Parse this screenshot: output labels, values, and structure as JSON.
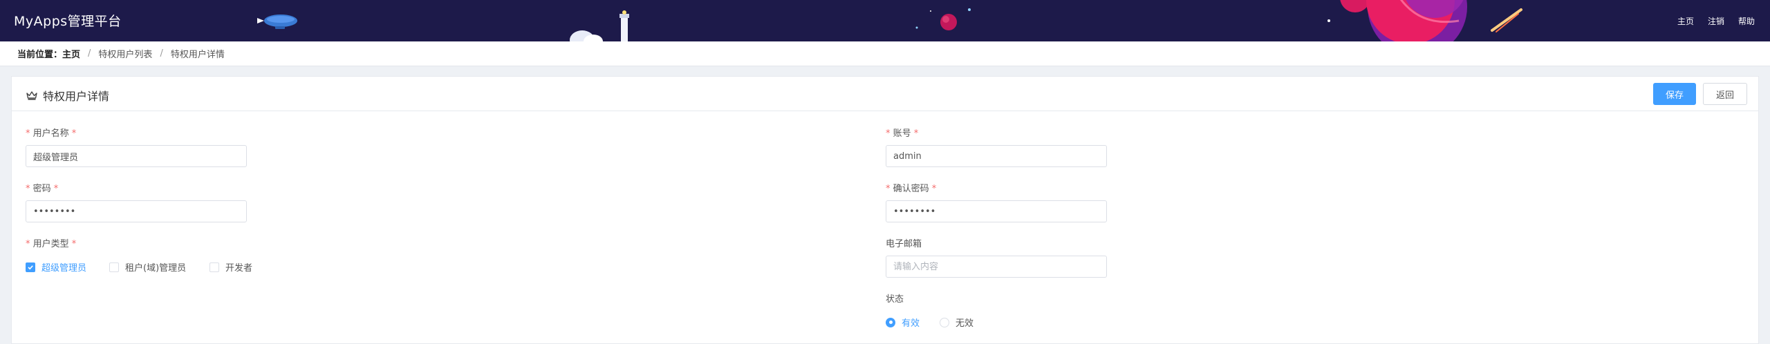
{
  "header": {
    "brand": "MyApps管理平台",
    "nav": [
      "主页",
      "注销",
      "帮助"
    ]
  },
  "breadcrumb": {
    "label": "当前位置：",
    "items": [
      "主页",
      "特权用户列表",
      "特权用户详情"
    ],
    "separator": "/"
  },
  "card": {
    "title": "特权用户详情",
    "save_label": "保存",
    "back_label": "返回"
  },
  "form": {
    "username": {
      "label": "用户名称",
      "value": "超级管理员"
    },
    "account": {
      "label": "账号",
      "value": "admin"
    },
    "password": {
      "label": "密码",
      "value": "••••••••"
    },
    "confirm_password": {
      "label": "确认密码",
      "value": "••••••••"
    },
    "user_type": {
      "label": "用户类型",
      "options": [
        {
          "label": "超级管理员",
          "checked": true
        },
        {
          "label": "租户(域)管理员",
          "checked": false
        },
        {
          "label": "开发者",
          "checked": false
        }
      ]
    },
    "email": {
      "label": "电子邮箱",
      "value": "",
      "placeholder": "请输入内容"
    },
    "status": {
      "label": "状态",
      "options": [
        {
          "label": "有效",
          "selected": true
        },
        {
          "label": "无效",
          "selected": false
        }
      ]
    },
    "required_mark": "*"
  },
  "colors": {
    "header_bg": "#1d1a4a",
    "primary": "#409eff",
    "required": "#f56c6c"
  }
}
